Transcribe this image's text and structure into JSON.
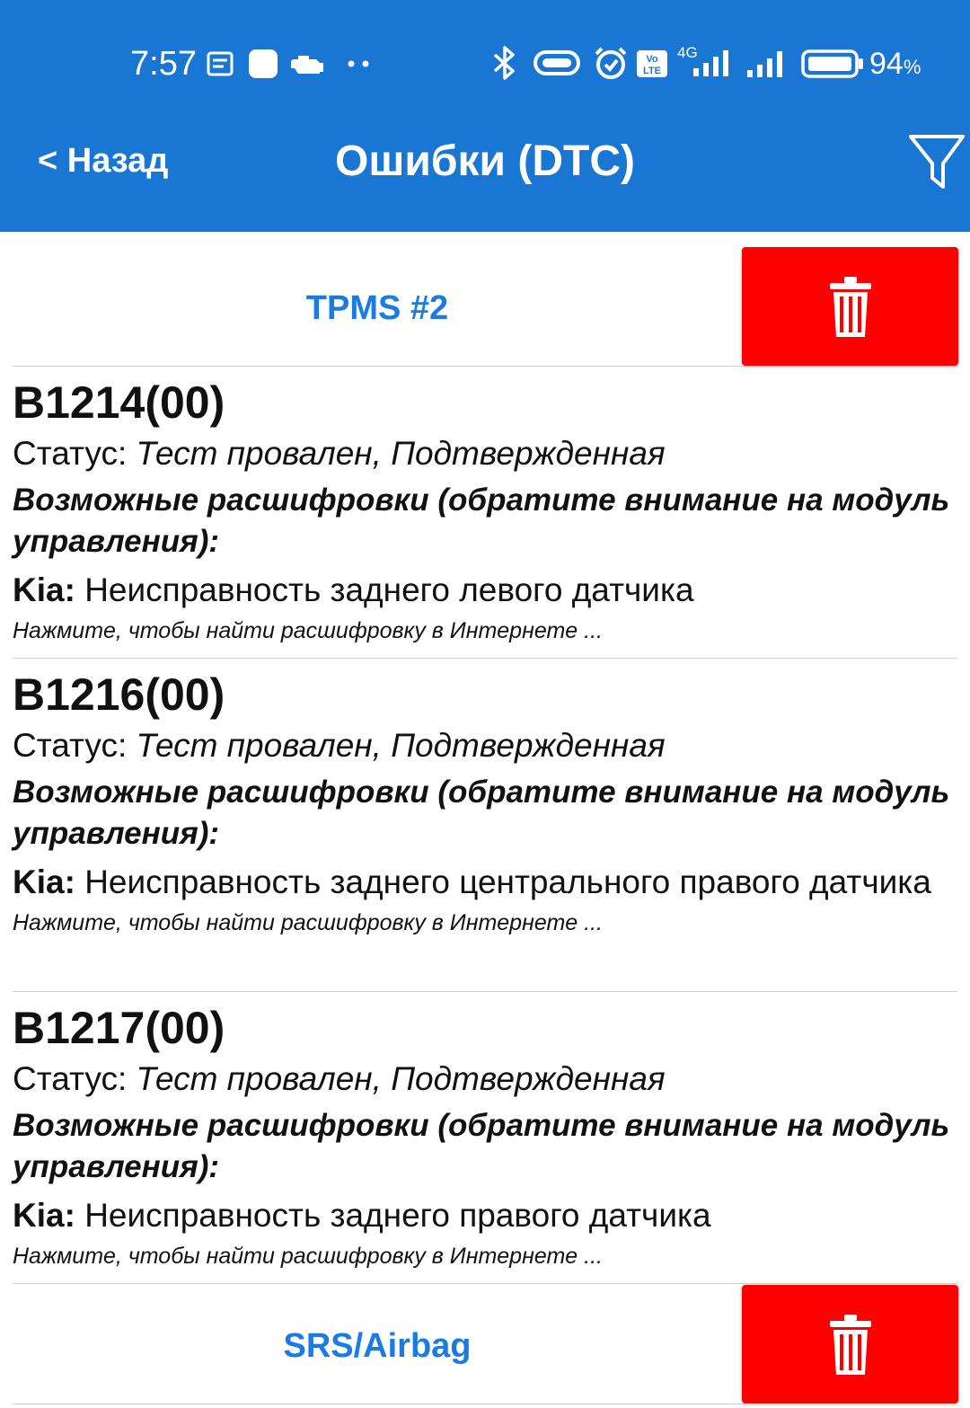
{
  "status_bar": {
    "time": "7:57",
    "battery": "94",
    "battery_unit": "%",
    "network": "4G",
    "volte": "Vo LTE",
    "icons": [
      "message-icon",
      "app-icon",
      "check-engine-icon",
      "more-dots-icon",
      "bluetooth-icon",
      "vpn-icon",
      "alarm-icon",
      "volte-icon",
      "signal-icon",
      "signal-icon",
      "battery-icon"
    ]
  },
  "header": {
    "back_label": "< Назад",
    "title": "Ошибки (DTC)",
    "filter_icon": "filter-icon"
  },
  "colors": {
    "header_bg": "#1976d2",
    "module_text": "#1a7be4",
    "delete_bg": "#ff0000"
  },
  "modules": [
    {
      "name": "TPMS #2",
      "dtcs": [
        {
          "code": "B1214(00)",
          "status_label": "Статус:",
          "status_value": "Тест провален, Подтвержденная",
          "hint_title": "Возможные расшифровки (обратите внимание на модуль управления):",
          "brand": "Kia:",
          "description": "Неисправность заднего левого датчика",
          "search_hint": "Нажмите, чтобы найти расшифровку в Интернете ..."
        },
        {
          "code": "B1216(00)",
          "status_label": "Статус:",
          "status_value": "Тест провален, Подтвержденная",
          "hint_title": "Возможные расшифровки (обратите внимание на модуль управления):",
          "brand": "Kia:",
          "description": "Неисправность заднего центрального правого датчика",
          "search_hint": "Нажмите, чтобы найти расшифровку в Интернете ..."
        },
        {
          "code": "B1217(00)",
          "status_label": "Статус:",
          "status_value": "Тест провален, Подтвержденная",
          "hint_title": "Возможные расшифровки (обратите внимание на модуль управления):",
          "brand": "Kia:",
          "description": "Неисправность заднего правого датчика",
          "search_hint": "Нажмите, чтобы найти расшифровку в Интернете ..."
        }
      ]
    },
    {
      "name": "SRS/Airbag",
      "dtcs": []
    }
  ]
}
